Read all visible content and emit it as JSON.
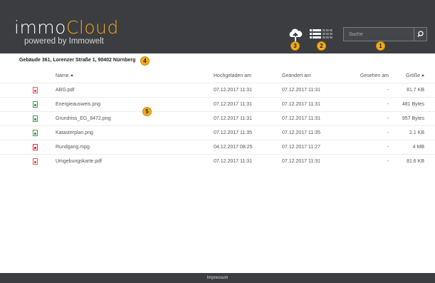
{
  "app": {
    "logo_part1": "immo",
    "logo_part2": "Cloud",
    "logo_sub": "powered by Immowelt",
    "brand_color": "#f3a51c",
    "header_color": "#3b3d40"
  },
  "toolbar": {
    "upload_icon": "cloud-upload-icon",
    "list_view_icon": "list-view-icon",
    "grid_view_icon": "grid-view-icon",
    "search_placeholder": "Suche",
    "search_value": "",
    "search_icon": "search-icon"
  },
  "badges": [
    "1",
    "2",
    "3",
    "4",
    "5"
  ],
  "breadcrumb": "Gebäude 361, Lorenzer Straße 1, 90402 Nürnberg",
  "table": {
    "columns": {
      "name": "Name",
      "uploaded": "Hochgeladen am",
      "modified": "Geändert am",
      "seen": "Gesehen am",
      "size": "Größe"
    },
    "rows": [
      {
        "type": "pdf",
        "name": "ABG.pdf",
        "uploaded": "07.12.2017 11:31",
        "modified": "07.12.2017 11:31",
        "seen": "-",
        "size": "81.7 KB"
      },
      {
        "type": "image",
        "name": "Energieausweis.png",
        "uploaded": "07.12.2017 11:31",
        "modified": "07.12.2017 11:31",
        "seen": "-",
        "size": "481 Bytes"
      },
      {
        "type": "image",
        "name": "Grundriss_EG_8472.png",
        "uploaded": "07.12.2017 11:31",
        "modified": "07.12.2017 11:31",
        "seen": "-",
        "size": "957 Bytes"
      },
      {
        "type": "image",
        "name": "Katasterplan.png",
        "uploaded": "07.12.2017 11:35",
        "modified": "07.12.2017 11:35",
        "seen": "-",
        "size": "2.1 KB"
      },
      {
        "type": "video",
        "name": "Rundgang.mpg",
        "uploaded": "04.12.2017 08:25",
        "modified": "07.12.2017 11:27",
        "seen": "-",
        "size": "4 MB"
      },
      {
        "type": "pdf",
        "name": "Umgebungskarte.pdf",
        "uploaded": "07.12.2017 11:31",
        "modified": "07.12.2017 11:31",
        "seen": "-",
        "size": "81.6 KB"
      }
    ]
  },
  "file_type_colors": {
    "pdf": "#e05a5a",
    "image": "#3f9f4f",
    "video": "#d9333f"
  },
  "footer": {
    "link": "Impressum"
  }
}
